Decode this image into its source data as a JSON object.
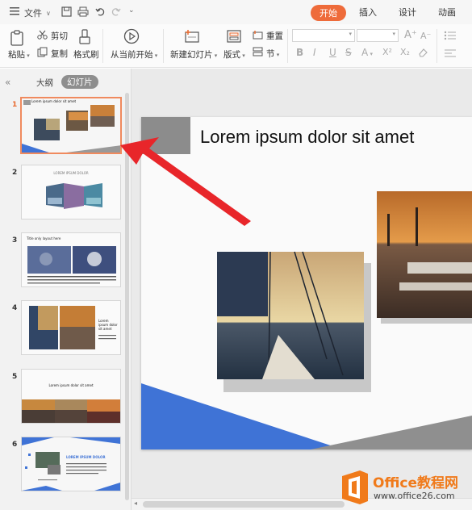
{
  "topbar": {
    "file_label": "文件",
    "tabs": [
      {
        "label": "开始",
        "active": true
      },
      {
        "label": "插入",
        "active": false
      },
      {
        "label": "设计",
        "active": false
      },
      {
        "label": "动画",
        "active": false
      }
    ]
  },
  "ribbon": {
    "paste": "粘贴",
    "cut": "剪切",
    "copy": "复制",
    "format_painter": "格式刷",
    "play_from_current": "从当前开始",
    "new_slide": "新建幻灯片",
    "layout": "版式",
    "reset": "重置",
    "section": "节",
    "font_buttons": [
      "B",
      "I",
      "U",
      "S",
      "A",
      "X²",
      "X₂"
    ],
    "font_grow": "A⁺",
    "font_shrink": "A⁻"
  },
  "panel": {
    "tab_outline": "大纲",
    "tab_slides": "幻灯片",
    "collapse_icon": "«",
    "thumbnails": [
      {
        "number": "1",
        "title": "Lorem ipsum dolor sit amet",
        "selected": true
      },
      {
        "number": "2",
        "title": "LOREM IPSUM DOLOR"
      },
      {
        "number": "3",
        "title": "Title only layout here"
      },
      {
        "number": "4",
        "title": "Lorem ipsum dolor sit amet"
      },
      {
        "number": "5",
        "title": "Lorem ipsum dolor sit amet"
      },
      {
        "number": "6",
        "title": "LOREM IPSUM DOLOR"
      }
    ]
  },
  "slide": {
    "title": "Lorem ipsum dolor sit amet"
  },
  "watermark": {
    "brand": "Office教程网",
    "url": "www.office26.com"
  },
  "colors": {
    "accent_tab": "#ee6b3a",
    "selected_thumb_border": "#f08a5e",
    "slide_blue": "#3f73d6",
    "slide_gray": "#8c8c8c",
    "arrow_red": "#e8262a",
    "logo_orange": "#f07a1a"
  }
}
